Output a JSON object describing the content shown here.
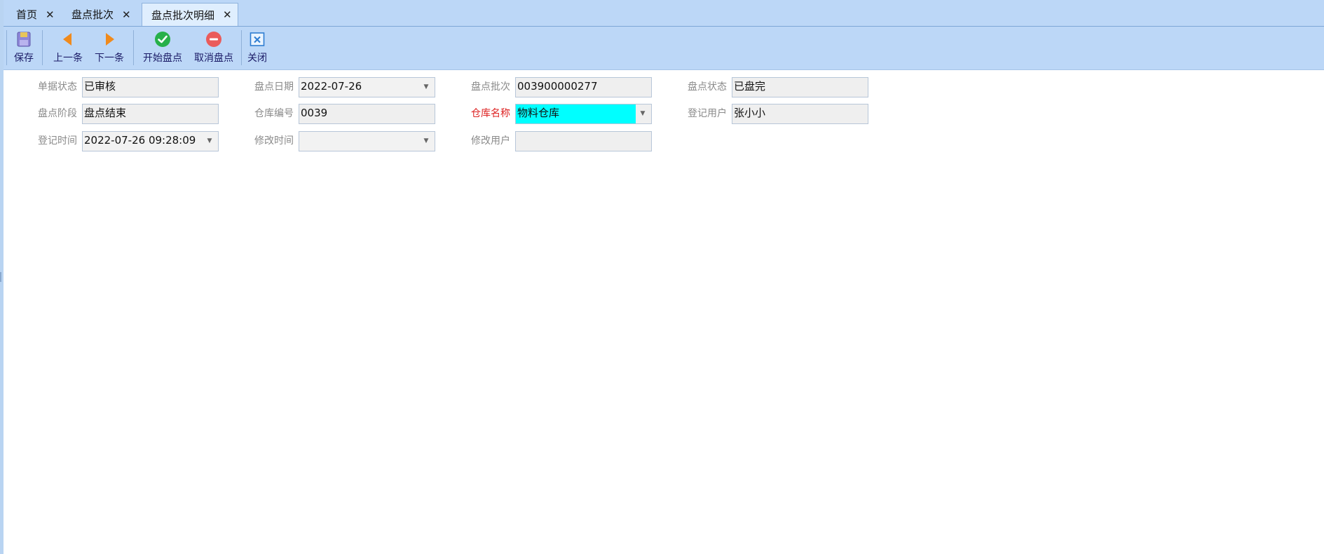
{
  "tabs": [
    {
      "label": "首页"
    },
    {
      "label": "盘点批次"
    },
    {
      "label": "盘点批次明细"
    }
  ],
  "toolbar": {
    "save": "保存",
    "prev": "上一条",
    "next": "下一条",
    "start": "开始盘点",
    "cancel": "取消盘点",
    "close": "关闭"
  },
  "form": {
    "doc_status": {
      "label": "单据状态",
      "value": "已审核"
    },
    "count_date": {
      "label": "盘点日期",
      "value": "2022-07-26"
    },
    "count_batch": {
      "label": "盘点批次",
      "value": "003900000277"
    },
    "count_status": {
      "label": "盘点状态",
      "value": "已盘完"
    },
    "count_stage": {
      "label": "盘点阶段",
      "value": "盘点结束"
    },
    "warehouse_code": {
      "label": "仓库编号",
      "value": "0039"
    },
    "warehouse_name": {
      "label": "仓库名称",
      "value": "物料仓库"
    },
    "reg_user": {
      "label": "登记用户",
      "value": "张小小"
    },
    "reg_time": {
      "label": "登记时间",
      "value": "2022-07-26 09:28:09"
    },
    "mod_time": {
      "label": "修改时间",
      "value": ""
    },
    "mod_user": {
      "label": "修改用户",
      "value": ""
    }
  },
  "colors": {
    "chrome": "#bcd7f7",
    "required_label": "#dd2222",
    "highlight_field": "#00ffff"
  },
  "icons": {
    "save": "save-disk-icon",
    "prev": "arrow-left-icon",
    "next": "arrow-right-icon",
    "start": "check-circle-icon",
    "cancel": "minus-circle-icon",
    "close": "close-window-icon"
  }
}
